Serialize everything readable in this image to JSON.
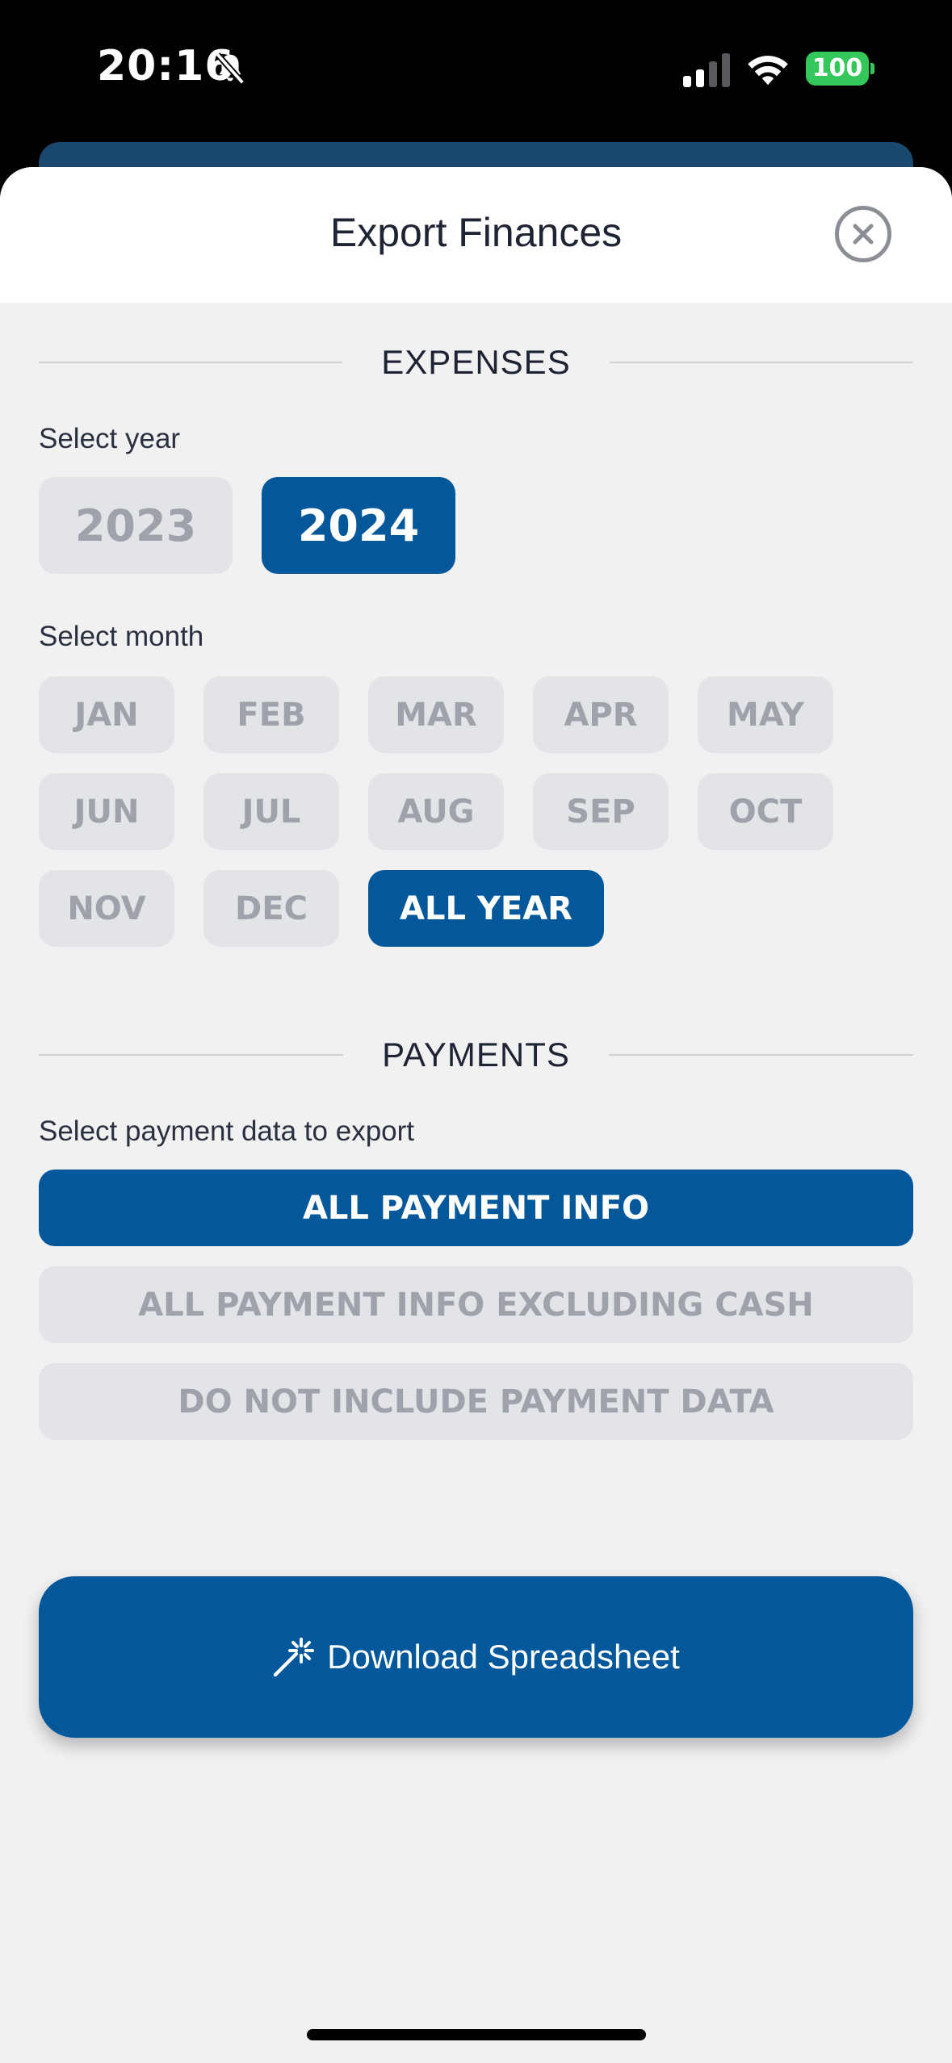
{
  "status_bar": {
    "time": "20:16",
    "battery": "100"
  },
  "sheet": {
    "title": "Export Finances"
  },
  "expenses": {
    "heading": "EXPENSES",
    "year_label": "Select year",
    "years": [
      {
        "label": "2023",
        "selected": false
      },
      {
        "label": "2024",
        "selected": true
      }
    ],
    "month_label": "Select month",
    "months": [
      {
        "label": "JAN",
        "selected": false
      },
      {
        "label": "FEB",
        "selected": false
      },
      {
        "label": "MAR",
        "selected": false
      },
      {
        "label": "APR",
        "selected": false
      },
      {
        "label": "MAY",
        "selected": false
      },
      {
        "label": "JUN",
        "selected": false
      },
      {
        "label": "JUL",
        "selected": false
      },
      {
        "label": "AUG",
        "selected": false
      },
      {
        "label": "SEP",
        "selected": false
      },
      {
        "label": "OCT",
        "selected": false
      },
      {
        "label": "NOV",
        "selected": false
      },
      {
        "label": "DEC",
        "selected": false
      },
      {
        "label": "ALL YEAR",
        "selected": true
      }
    ]
  },
  "payments": {
    "heading": "PAYMENTS",
    "label": "Select payment data to export",
    "options": [
      {
        "label": "ALL PAYMENT INFO",
        "selected": true
      },
      {
        "label": "ALL PAYMENT INFO EXCLUDING CASH",
        "selected": false
      },
      {
        "label": "DO NOT INCLUDE PAYMENT DATA",
        "selected": false
      }
    ]
  },
  "download_button": {
    "label": "Download Spreadsheet",
    "icon": "magic-wand-icon"
  },
  "colors": {
    "accent": "#02589a",
    "chip_off": "#e3e4e8",
    "chip_off_text": "#9ea2ab",
    "battery": "#34c759"
  }
}
